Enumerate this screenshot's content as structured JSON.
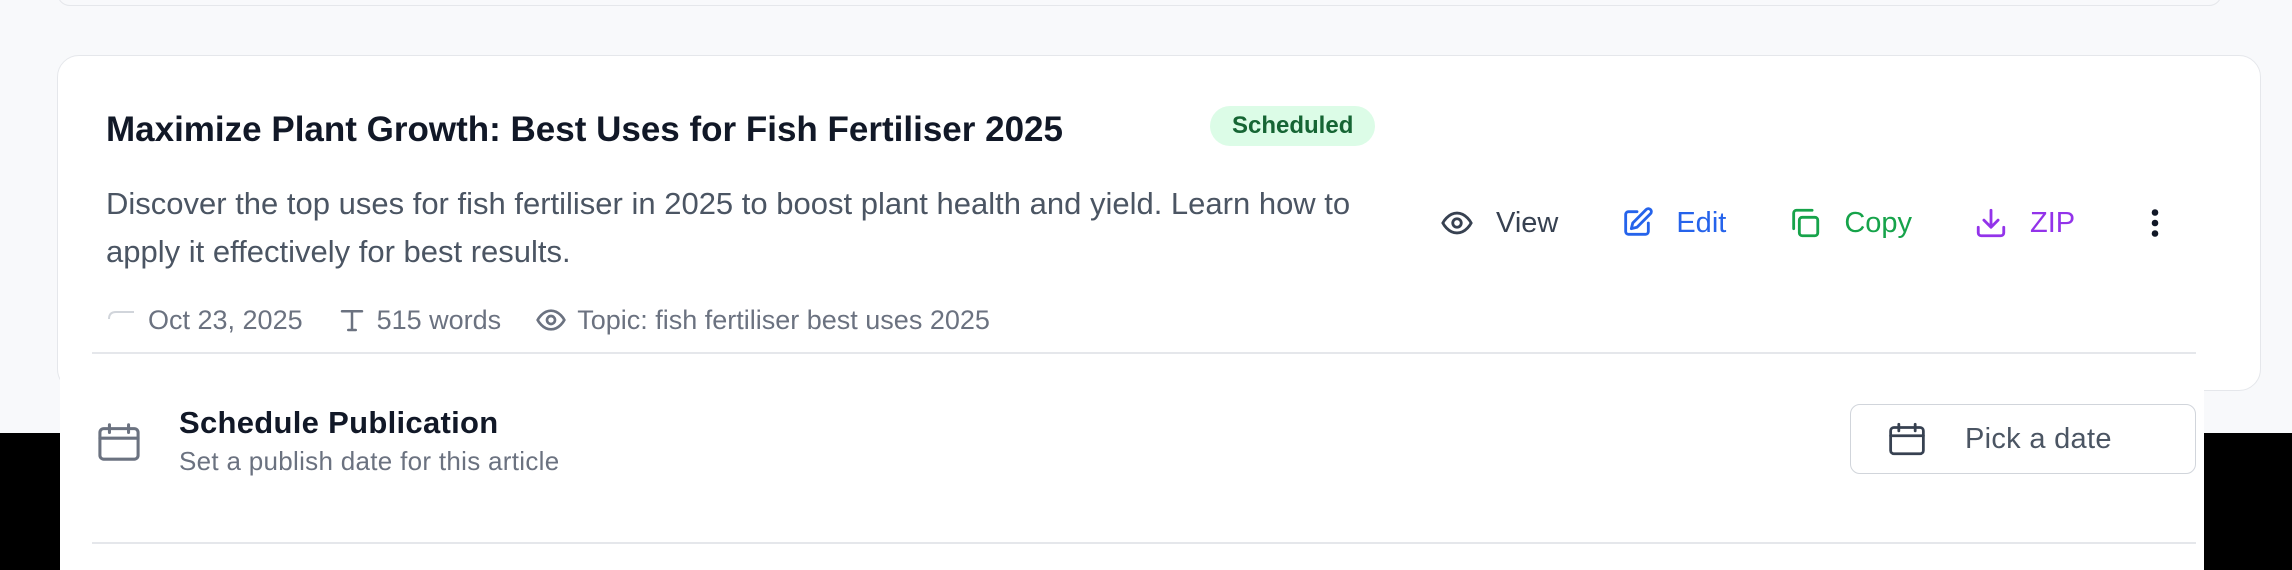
{
  "article": {
    "title": "Maximize Plant Growth: Best Uses for Fish Fertiliser 2025",
    "status": "Scheduled",
    "description": "Discover the top uses for fish fertiliser in 2025 to boost plant health and yield. Learn how to apply it effectively for best results.",
    "meta": {
      "date": "Oct 23, 2025",
      "words": "515 words",
      "topic": "Topic: fish fertiliser best uses 2025"
    },
    "actions": {
      "view": "View",
      "edit": "Edit",
      "copy": "Copy",
      "zip": "ZIP"
    }
  },
  "schedule": {
    "title": "Schedule Publication",
    "subtitle": "Set a publish date for this article",
    "date_button": "Pick a date"
  },
  "colors": {
    "badge_bg": "#dcfce7",
    "badge_text": "#166534",
    "edit": "#2563eb",
    "copy": "#16a34a",
    "zip": "#9333ea"
  }
}
